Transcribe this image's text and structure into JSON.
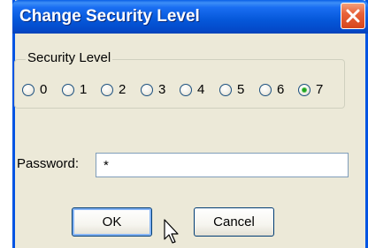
{
  "window": {
    "title": "Change Security Level"
  },
  "security_group": {
    "legend": "Security Level",
    "options": [
      "0",
      "1",
      "2",
      "3",
      "4",
      "5",
      "6",
      "7"
    ],
    "selected": "7"
  },
  "password": {
    "label": "Password:",
    "value": "*"
  },
  "buttons": {
    "ok": "OK",
    "cancel": "Cancel"
  },
  "colors": {
    "titlebar": "#0557d9",
    "window_bg": "#ece9d8",
    "close_button": "#e8633a",
    "selected_radio": "#21a121"
  },
  "icons": {
    "close": "close-icon",
    "cursor": "mouse-pointer-icon"
  }
}
